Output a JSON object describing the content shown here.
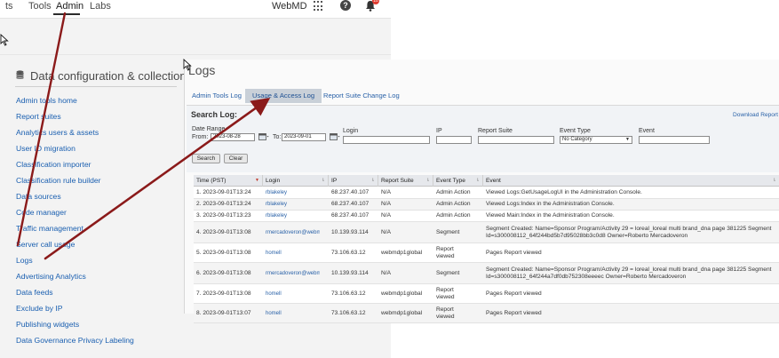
{
  "topnav": {
    "items": [
      "ts",
      "Tools",
      "Admin",
      "Labs"
    ],
    "org": "WebMD",
    "badge": "10"
  },
  "sidebar": {
    "section_title": "Data configuration & collection",
    "links": [
      "Admin tools home",
      "Report suites",
      "Analytics users & assets",
      "User ID migration",
      "Classification importer",
      "Classification rule builder",
      "Data sources",
      "Code manager",
      "Traffic management",
      "Server call usage",
      "Logs",
      "Advertising Analytics",
      "Data feeds",
      "Exclude by IP",
      "Publishing widgets",
      "Data Governance Privacy Labeling"
    ]
  },
  "logs": {
    "title": "Logs",
    "tabs": [
      "Admin Tools Log",
      "Usage & Access Log",
      "Report Suite Change Log"
    ],
    "active_tab": 1,
    "search": {
      "title": "Search Log:",
      "download": "Download Report",
      "date_range_label": "Date Range",
      "from_label": "From:",
      "from_value": "2023-08-28",
      "to_label": "To:",
      "to_value": "2023-09-01",
      "login_label": "Login",
      "ip_label": "IP",
      "report_suite_label": "Report Suite",
      "event_type_label": "Event Type",
      "event_type_value": "No Category",
      "event_label": "Event",
      "search_button": "Search",
      "clear_button": "Clear"
    },
    "columns": [
      "Time (PST)",
      "Login",
      "IP",
      "Report Suite",
      "Event Type",
      "Event"
    ],
    "rows": [
      {
        "time": "1. 2023-09-01T13:24",
        "login": "rblakeley",
        "ip": "68.237.40.107",
        "suite": "N/A",
        "type": "Admin Action",
        "event": "Viewed Logs:GetUsageLogUI in the Administration Console."
      },
      {
        "time": "2. 2023-09-01T13:24",
        "login": "rblakeley",
        "ip": "68.237.40.107",
        "suite": "N/A",
        "type": "Admin Action",
        "event": "Viewed Logs:Index in the Administration Console."
      },
      {
        "time": "3. 2023-09-01T13:23",
        "login": "rblakeley",
        "ip": "68.237.40.107",
        "suite": "N/A",
        "type": "Admin Action",
        "event": "Viewed Main:Index in the Administration Console."
      },
      {
        "time": "4. 2023-09-01T13:08",
        "login": "rmercadoveron@webmd.net",
        "ip": "10.139.93.114",
        "suite": "N/A",
        "type": "Segment",
        "event": "Segment Created: Name=Sponsor Program/Activity 29 = loreal_loreal multi brand_dna page 381225 Segment Id=s300008112_64f244bd5b7d95028bb3c0d8 Owner=Roberto Mercadoveron"
      },
      {
        "time": "5. 2023-09-01T13:08",
        "login": "homell",
        "ip": "73.106.63.12",
        "suite": "webmdp1global",
        "type": "Report viewed",
        "event": "Pages Report viewed"
      },
      {
        "time": "6. 2023-09-01T13:08",
        "login": "rmercadoveron@webmd.net",
        "ip": "10.139.93.114",
        "suite": "N/A",
        "type": "Segment",
        "event": "Segment Created: Name=Sponsor Program/Activity 29 = loreal_loreal multi brand_dna page 381225 Segment Id=s300008112_64f244a7df0db752308eeeec Owner=Roberto Mercadoveron"
      },
      {
        "time": "7. 2023-09-01T13:08",
        "login": "homell",
        "ip": "73.106.63.12",
        "suite": "webmdp1global",
        "type": "Report viewed",
        "event": "Pages Report viewed"
      },
      {
        "time": "8. 2023-09-01T13:07",
        "login": "homell",
        "ip": "73.106.63.12",
        "suite": "webmdp1global",
        "type": "Report viewed",
        "event": "Pages Report viewed"
      }
    ]
  },
  "colors": {
    "link": "#1a5fb0",
    "arrow": "#8b1a1a",
    "active_tab_bg": "#c9d0d8",
    "sidebar_bg": "#f3f3f3"
  },
  "icons": [
    "apps-grid-icon",
    "help-icon",
    "bell-icon",
    "database-icon",
    "calendar-icon",
    "mouse-cursor-icon"
  ]
}
